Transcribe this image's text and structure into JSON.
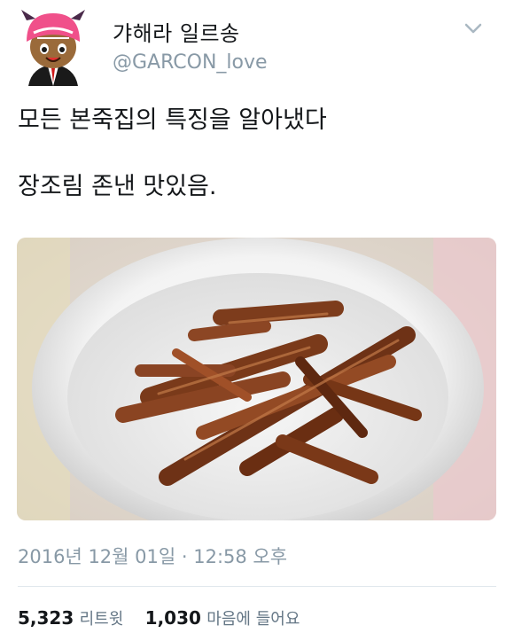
{
  "user": {
    "display_name": "갸해라 일르송",
    "handle": "@GARCON_love"
  },
  "tweet": {
    "line1": "모든 본죽집의 특징을 알아냈다",
    "line2": "장조림 존낸 맛있음."
  },
  "meta": {
    "timestamp": "2016년 12월 01일 · 12:58 오후"
  },
  "stats": {
    "retweets_count": "5,323",
    "retweets_label": "리트윗",
    "likes_count": "1,030",
    "likes_label": "마음에 들어요"
  },
  "colors": {
    "text": "#14171a",
    "secondary": "#8899a6",
    "divider": "#e1e8ed"
  },
  "icons": {
    "caret": "chevron-down-icon"
  }
}
